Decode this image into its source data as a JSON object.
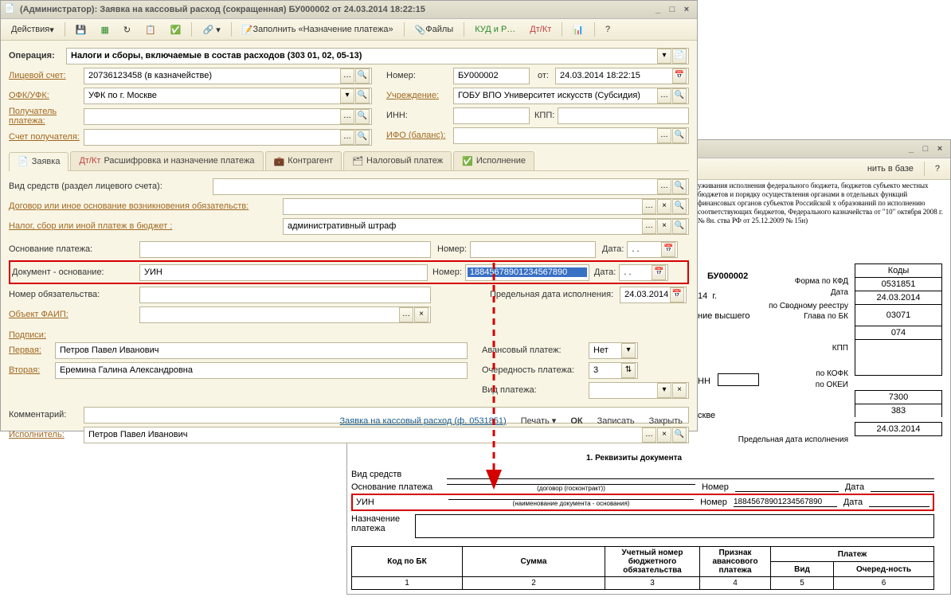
{
  "window1": {
    "title": "(Администратор): Заявка на кассовый расход (сокращенная) БУ000002 от 24.03.2014 18:22:15",
    "toolbar": {
      "actions": "Действия",
      "fill": "Заполнить «Назначение платежа»",
      "files": "Файлы",
      "kud": "КУД и Р…"
    },
    "operation_label": "Операция:",
    "operation": "Налоги и сборы, включаемые в состав расходов (303 01, 02, 05-13)",
    "labels": {
      "account": "Лицевой счет:",
      "ofk": "ОФК/УФК:",
      "payee": "Получатель платежа:",
      "payee_acct": "Счет получателя:",
      "number": "Номер:",
      "from": "от:",
      "org": "Учреждение:",
      "inn": "ИНН:",
      "kpp": "КПП:",
      "ifo": "ИФО (баланс):"
    },
    "account": "20736123458 (в казначействе)",
    "ofk": "УФК по г. Москве",
    "number": "БУ000002",
    "date": "24.03.2014 18:22:15",
    "org": "ГОБУ ВПО Университет искусств (Субсидия)",
    "tabs": [
      "Заявка",
      "Расшифровка и назначение платежа",
      "Контрагент",
      "Налоговый платеж",
      "Исполнение"
    ],
    "form": {
      "vid_sredstv_lbl": "Вид средств (раздел лицевого счета):",
      "dogovor_lbl": "Договор или иное основание возникновения обязательств:",
      "nalog_lbl": "Налог, сбор или иной платеж в бюджет :",
      "nalog_val": "административный штраф",
      "osn_lbl": "Основание платежа:",
      "num_lbl": "Номер:",
      "date_lbl": "Дата:",
      "date_placeholder": "  .  .",
      "doc_osn_lbl": "Документ - основание:",
      "doc_osn_val": "УИН",
      "doc_num": "18845678901234567890",
      "nomer_ob_lbl": "Номер обязательства:",
      "pred_date_lbl": "Предельная дата исполнения:",
      "pred_date": "24.03.2014",
      "faip_lbl": "Объект ФАИП:",
      "podpisi": "Подписи:",
      "first_lbl": "Первая:",
      "first": "Петров Павел Иванович",
      "second_lbl": "Вторая:",
      "second": "Еремина Галина Александровна",
      "avans_lbl": "Авансовый платеж:",
      "avans": "Нет",
      "ochered_lbl": "Очередность платежа:",
      "ochered": "3",
      "vid_plat_lbl": "Вид платежа:",
      "comment_lbl": "Комментарий:",
      "exec_lbl": "Исполнитель:",
      "exec": "Петров Павел Иванович"
    },
    "footer": {
      "name": "Заявка на кассовый расход (ф. 0531851)",
      "print": "Печать",
      "ok": "ОК",
      "save": "Записать",
      "close": "Закрыть"
    }
  },
  "window2": {
    "toolbar": {
      "savebase": "нить в базе"
    },
    "about": "уживания исполнения федерального бюджета, бюджетов субъекто местных бюджетов и порядку осуществления органами в отдельных функций финансовых органов субъектов Российской х образований по исполнению соответствующих бюджетов, Федерального казначейства от \"10\" октября 2008 г. № 8н. ства РФ от 25.12.2009 № 15н)",
    "form": {
      "number": "БУ000002",
      "year_spacer": "14",
      "year_tail": "г.",
      "edu": "ние высшего",
      "inn_lbl": "НН",
      "loc": "скве",
      "codes_header": "Коды",
      "labels": {
        "kfd": "Форма по КФД",
        "date": "Дата",
        "svod": "по Сводному реестру",
        "glavabk": "Глава по БК",
        "kpp": "КПП",
        "kofk": "по КОФК",
        "okei": "по ОКЕИ",
        "pred": "Предельная дата исполнения"
      },
      "codes": {
        "kfd": "0531851",
        "date": "24.03.2014",
        "svod": "03071",
        "glavabk": "074",
        "kofk": "7300",
        "okei": "383",
        "pred": "24.03.2014"
      },
      "section1": "1. Реквизиты документа",
      "rows": {
        "vid": "Вид средств",
        "osn": "Основание платежа",
        "osn_note": "(договор (госконтракт))",
        "uin": "УИН",
        "uin_note": "(наименование документа - основания)",
        "num": "Номер",
        "date": "Дата",
        "uin_num": "18845678901234567890",
        "nazn": "Назначение платежа"
      },
      "table_headers": [
        "Код по БК",
        "Сумма",
        "Учетный номер бюджетного обязательства",
        "Признак авансового платежа",
        "Вид",
        "Очеред-ность"
      ],
      "table_sup": "Платеж",
      "table_nums": [
        "1",
        "2",
        "3",
        "4",
        "5",
        "6"
      ]
    }
  }
}
